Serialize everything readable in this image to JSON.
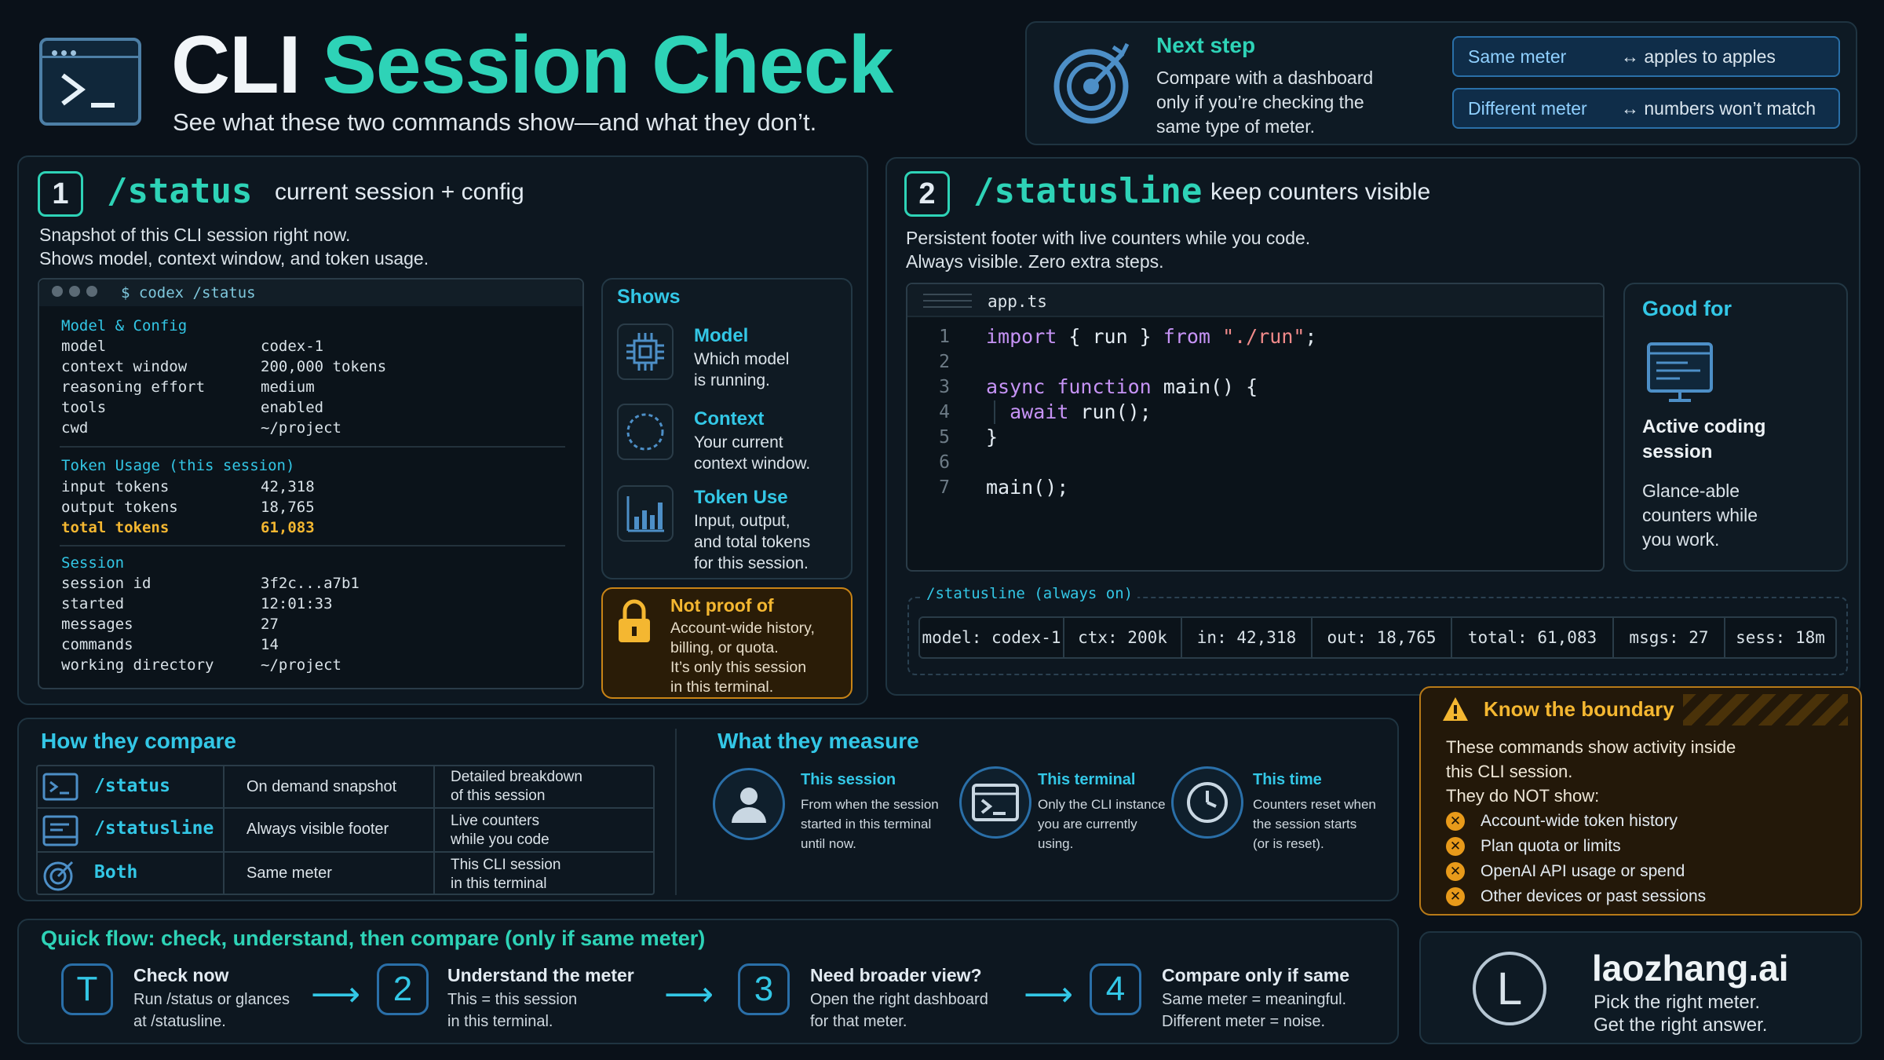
{
  "header": {
    "title_a": "CLI",
    "title_b": "Session Check",
    "subtitle": "See what these two commands show—and what they don’t."
  },
  "next_step": {
    "title": "Next step",
    "desc": [
      "Compare with a dashboard",
      "only if you’re checking the",
      "same type of meter."
    ],
    "rows": [
      {
        "key": "Same meter",
        "val": "↔ apples to apples"
      },
      {
        "key": "Different meter",
        "val": "↔ numbers won’t match"
      }
    ]
  },
  "status": {
    "num": "1",
    "cmd": "/status",
    "tagline": "current session + config",
    "desc": [
      "Snapshot of this CLI session right now.",
      "Shows model, context window, and token usage."
    ],
    "terminal_title": "$ codex /status",
    "sec_model": "Model & Config",
    "model_rows": [
      {
        "k": "model",
        "v": "codex-1"
      },
      {
        "k": "context window",
        "v": "200,000 tokens"
      },
      {
        "k": "reasoning effort",
        "v": "medium"
      },
      {
        "k": "tools",
        "v": "enabled"
      },
      {
        "k": "cwd",
        "v": "~/project"
      }
    ],
    "sec_tokens": "Token Usage (this session)",
    "token_rows": [
      {
        "k": "input tokens",
        "v": "42,318"
      },
      {
        "k": "output tokens",
        "v": "18,765"
      },
      {
        "k": "total tokens",
        "v": "61,083"
      }
    ],
    "sec_session": "Session",
    "session_rows": [
      {
        "k": "session id",
        "v": "3f2c...a7b1"
      },
      {
        "k": "started",
        "v": "12:01:33"
      },
      {
        "k": "messages",
        "v": "27"
      },
      {
        "k": "commands",
        "v": "14"
      },
      {
        "k": "working directory",
        "v": "~/project"
      }
    ],
    "shows_title": "Shows",
    "shows": [
      {
        "icon": "chip-icon",
        "title": "Model",
        "desc": [
          "Which model",
          "is running."
        ]
      },
      {
        "icon": "dashed-circle-icon",
        "title": "Context",
        "desc": [
          "Your current",
          "context window."
        ]
      },
      {
        "icon": "bar-chart-icon",
        "title": "Token Use",
        "desc": [
          "Input, output,",
          "and total tokens",
          "for this session."
        ]
      }
    ],
    "not_proof_title": "Not proof of",
    "not_proof_desc": [
      "Account-wide history,",
      "billing, or quota.",
      "It’s only this session",
      "in this terminal."
    ]
  },
  "statusline": {
    "num": "2",
    "cmd": "/statusline",
    "tagline": "keep counters visible",
    "desc": [
      "Persistent footer with live counters while you code.",
      "Always visible. Zero extra steps."
    ],
    "file_tab": "app.ts",
    "code_lines": [
      "1",
      "2",
      "3",
      "4",
      "5",
      "6",
      "7"
    ],
    "good_for_title": "Good for",
    "good_for_main": [
      "Active coding",
      "session"
    ],
    "good_for_desc": [
      "Glance-able",
      "counters while",
      "you work."
    ],
    "bar_label": "/statusline (always on)",
    "bar_cells": [
      "model: codex-1",
      "ctx: 200k",
      "in: 42,318",
      "out: 18,765",
      "total: 61,083",
      "msgs: 27",
      "sess: 18m"
    ]
  },
  "compare": {
    "title": "How they compare",
    "rows": [
      {
        "cmd": "/status",
        "when": "On demand snapshot",
        "what": [
          "Detailed breakdown",
          "of this session"
        ]
      },
      {
        "cmd": "/statusline",
        "when": "Always visible footer",
        "what": [
          "Live counters",
          "while you code"
        ]
      },
      {
        "cmd": "Both",
        "when": "Same meter",
        "what": [
          "This CLI session",
          "in this terminal"
        ]
      }
    ]
  },
  "measure": {
    "title": "What they measure",
    "items": [
      {
        "title": "This session",
        "desc": [
          "From when the session",
          "started in this terminal",
          "until now."
        ]
      },
      {
        "title": "This terminal",
        "desc": [
          "Only the CLI instance",
          "you are currently",
          "using."
        ]
      },
      {
        "title": "This time",
        "desc": [
          "Counters reset when",
          "the session starts",
          "(or is reset)."
        ]
      }
    ]
  },
  "boundary": {
    "title": "Know the boundary",
    "desc": [
      "These commands show activity inside",
      "this CLI session.",
      "They do NOT show:"
    ],
    "items": [
      "Account-wide token history",
      "Plan quota or limits",
      "OpenAI API usage or spend",
      "Other devices or past sessions"
    ]
  },
  "flow": {
    "title": "Quick flow: check, understand, then compare (only if same meter)",
    "steps": [
      {
        "num": "T",
        "title": "Check now",
        "desc": [
          "Run /status or glances",
          "at /statusline."
        ]
      },
      {
        "num": "2",
        "title": "Understand the meter",
        "desc": [
          "This = this session",
          "in this terminal."
        ]
      },
      {
        "num": "3",
        "title": "Need broader view?",
        "desc": [
          "Open the right dashboard",
          "for that meter."
        ]
      },
      {
        "num": "4",
        "title": "Compare only if same",
        "desc": [
          "Same meter = meaningful.",
          "Different meter = noise."
        ]
      }
    ]
  },
  "brand": {
    "logo_letter": "L",
    "name": "laozhang.ai",
    "line1": "Pick the right meter.",
    "line2": "Get the right answer."
  },
  "colors": {
    "accent": "#2ed3b7",
    "link": "#33c7e6",
    "warning": "#f4b731",
    "background": "#0a1119"
  }
}
